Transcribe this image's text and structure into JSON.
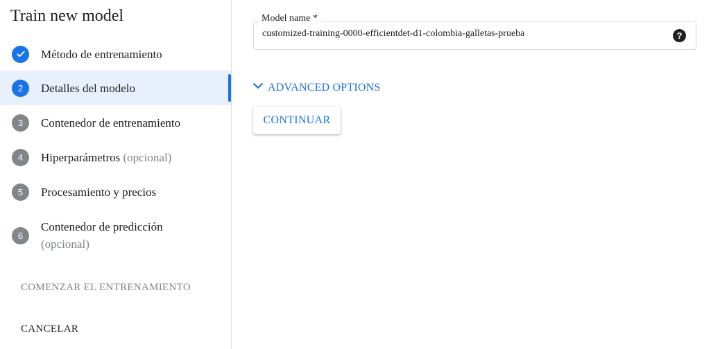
{
  "page_title": "Train new model",
  "steps": [
    {
      "number": "",
      "label": "Método de entrenamiento",
      "optional": ""
    },
    {
      "number": "2",
      "label": "Detalles del modelo",
      "optional": ""
    },
    {
      "number": "3",
      "label": "Contenedor de entrenamiento",
      "optional": ""
    },
    {
      "number": "4",
      "label": "Hiperparámetros",
      "optional": "(opcional)"
    },
    {
      "number": "5",
      "label": "Procesamiento y precios",
      "optional": ""
    },
    {
      "number": "6",
      "label": "Contenedor de predicción",
      "optional": "(opcional)"
    }
  ],
  "sidebar_actions": {
    "start_training_label": "COMENZAR EL ENTRENAMIENTO",
    "cancel_label": "CANCELAR"
  },
  "model_name_field": {
    "label": "Model name *",
    "value": "customized-training-0000-efficientdet-d1-colombia-galletas-prueba",
    "help_icon": "?"
  },
  "advanced_options": {
    "label": "ADVANCED OPTIONS"
  },
  "continue_button": {
    "label": "CONTINUAR"
  },
  "colors": {
    "accent": "#1a73e8",
    "active_step_bg": "#e8f0fe",
    "pending_step": "#80868b",
    "disabled_text": "#80868b"
  }
}
